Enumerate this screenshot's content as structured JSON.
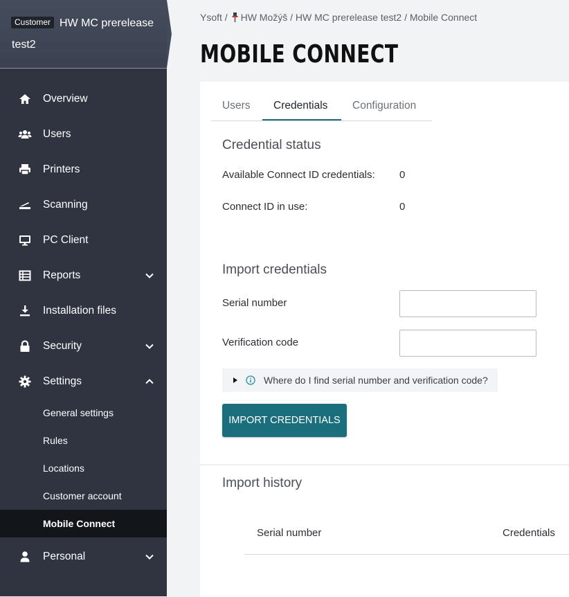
{
  "sidebar": {
    "customer_badge": "Customer",
    "customer_name": "HW MC prerelease test2",
    "items": [
      {
        "label": "Overview",
        "icon": "home-icon"
      },
      {
        "label": "Users",
        "icon": "users-icon"
      },
      {
        "label": "Printers",
        "icon": "printer-icon"
      },
      {
        "label": "Scanning",
        "icon": "scanner-icon"
      },
      {
        "label": "PC Client",
        "icon": "monitor-icon"
      },
      {
        "label": "Reports",
        "icon": "table-icon",
        "expandable": true
      },
      {
        "label": "Installation files",
        "icon": "download-icon"
      },
      {
        "label": "Security",
        "icon": "lock-icon",
        "expandable": true
      },
      {
        "label": "Settings",
        "icon": "gear-icon",
        "expanded": true
      },
      {
        "label": "Personal",
        "icon": "person-icon",
        "expandable": true
      }
    ],
    "settings_sub": [
      "General settings",
      "Rules",
      "Locations",
      "Customer account",
      "Mobile Connect"
    ],
    "active_sub": "Mobile Connect"
  },
  "breadcrumb": [
    "Ysoft",
    "HW Možýš",
    "HW MC prerelease test2",
    "Mobile Connect"
  ],
  "page_title": "MOBILE CONNECT",
  "tabs": [
    "Users",
    "Credentials",
    "Configuration"
  ],
  "active_tab": "Credentials",
  "credential_status": {
    "heading": "Credential status",
    "available_label": "Available Connect ID credentials:",
    "available_value": "0",
    "in_use_label": "Connect ID in use:",
    "in_use_value": "0"
  },
  "import": {
    "heading": "Import credentials",
    "serial_label": "Serial number",
    "serial_value": "",
    "verification_label": "Verification code",
    "verification_value": "",
    "help_text": "Where do I find serial number and verification code?",
    "button": "IMPORT CREDENTIALS"
  },
  "history": {
    "heading": "Import history",
    "columns": [
      "Serial number",
      "Credentials"
    ]
  },
  "colors": {
    "sidebar_bg": "#2f3440",
    "accent": "#1b6f7d",
    "active_sub_bg": "#12151a"
  }
}
